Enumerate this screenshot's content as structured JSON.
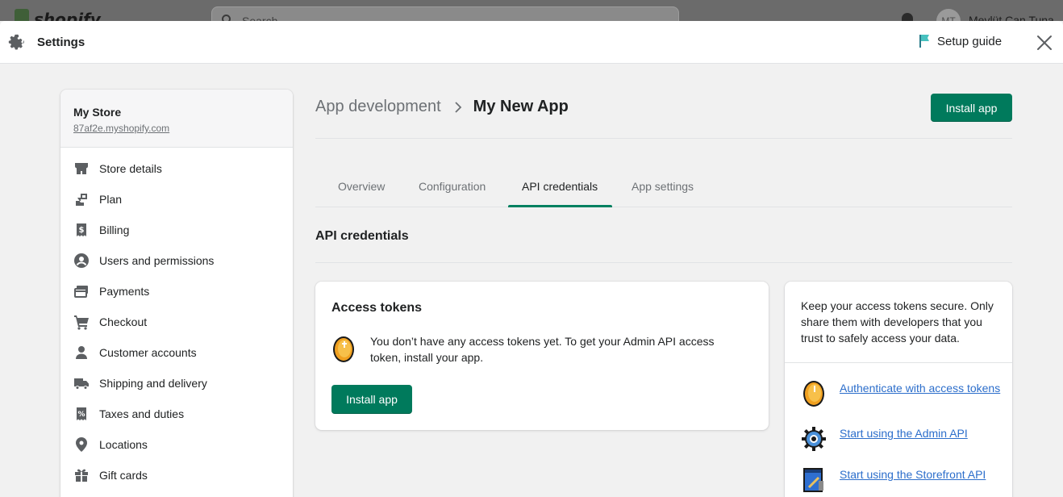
{
  "background": {
    "logo_text": "shopify",
    "search_placeholder": "Search",
    "user_initials": "MT",
    "user_name": "Mevlüt Can Tuna"
  },
  "header": {
    "title": "Settings",
    "setup_guide_label": "Setup guide",
    "icons": {
      "settings": "gear-icon",
      "setup": "flag-icon",
      "close": "close-icon"
    }
  },
  "sidebar": {
    "store_name": "My Store",
    "store_domain": "87af2e.myshopify.com",
    "items": [
      {
        "label": "Store details",
        "icon": "store-icon"
      },
      {
        "label": "Plan",
        "icon": "plan-icon"
      },
      {
        "label": "Billing",
        "icon": "billing-icon"
      },
      {
        "label": "Users and permissions",
        "icon": "user-circle-icon"
      },
      {
        "label": "Payments",
        "icon": "payments-icon"
      },
      {
        "label": "Checkout",
        "icon": "cart-icon"
      },
      {
        "label": "Customer accounts",
        "icon": "person-icon"
      },
      {
        "label": "Shipping and delivery",
        "icon": "truck-icon"
      },
      {
        "label": "Taxes and duties",
        "icon": "tax-icon"
      },
      {
        "label": "Locations",
        "icon": "location-pin-icon"
      },
      {
        "label": "Gift cards",
        "icon": "gift-icon"
      }
    ]
  },
  "main": {
    "breadcrumb_parent": "App development",
    "breadcrumb_current": "My New App",
    "install_button": "Install app",
    "tabs": [
      {
        "label": "Overview",
        "active": false
      },
      {
        "label": "Configuration",
        "active": false
      },
      {
        "label": "API credentials",
        "active": true
      },
      {
        "label": "App settings",
        "active": false
      }
    ],
    "section_title": "API credentials",
    "access_tokens_card": {
      "title": "Access tokens",
      "message": "You don’t have any access tokens yet. To get your Admin API access token, install your app.",
      "button": "Install app"
    },
    "help_card": {
      "text": "Keep your access tokens secure. Only share them with developers that you trust to safely access your data.",
      "links": [
        {
          "label": "Authenticate with access tokens",
          "icon": "coin-token-icon"
        },
        {
          "label": "Start using the Admin API",
          "icon": "gear-cog-icon"
        },
        {
          "label": "Start using the Storefront API",
          "icon": "storefront-blueprint-icon"
        }
      ]
    }
  },
  "colors": {
    "primary_button": "#007a5c",
    "active_tab_underline": "#008060",
    "link": "#2c6ecb",
    "flag": "#47c1bf"
  }
}
